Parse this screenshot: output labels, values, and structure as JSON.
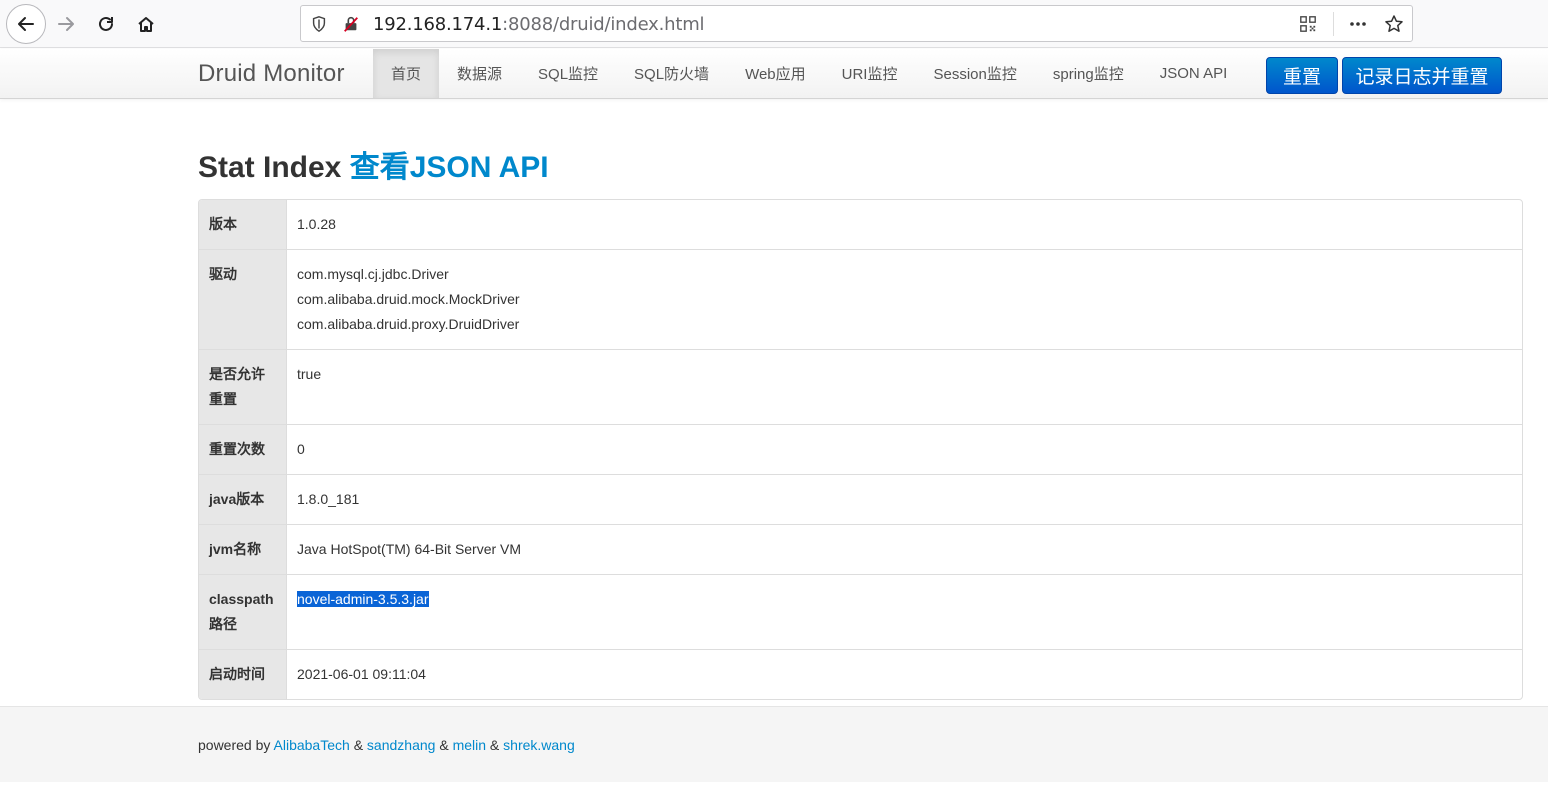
{
  "browser": {
    "url_host": "192.168.174.1",
    "url_rest": ":8088/druid/index.html"
  },
  "navbar": {
    "brand": "Druid Monitor",
    "items": [
      "首页",
      "数据源",
      "SQL监控",
      "SQL防火墙",
      "Web应用",
      "URI监控",
      "Session监控",
      "spring监控",
      "JSON API"
    ],
    "active_index": 0,
    "reset_label": "重置",
    "log_reset_label": "记录日志并重置"
  },
  "main": {
    "title": "Stat Index",
    "title_link": "查看JSON API",
    "rows": {
      "version": {
        "label": "版本",
        "value": "1.0.28"
      },
      "drivers": {
        "label": "驱动",
        "values": [
          "com.mysql.cj.jdbc.Driver",
          "com.alibaba.druid.mock.MockDriver",
          "com.alibaba.druid.proxy.DruidDriver"
        ]
      },
      "reset_enable": {
        "label": "是否允许重置",
        "value": "true"
      },
      "reset_count": {
        "label": "重置次数",
        "value": "0"
      },
      "java_version": {
        "label": "java版本",
        "value": "1.8.0_181"
      },
      "jvm_name": {
        "label": "jvm名称",
        "value": "Java HotSpot(TM) 64-Bit Server VM"
      },
      "classpath": {
        "label": "classpath路径",
        "value": "novel-admin-3.5.3.jar"
      },
      "start_time": {
        "label": "启动时间",
        "value": "2021-06-01 09:11:04"
      }
    }
  },
  "footer": {
    "prefix": "powered by",
    "sep": "&",
    "authors": [
      "AlibabaTech",
      "sandzhang",
      "melin",
      "shrek.wang"
    ]
  },
  "colors": {
    "link": "#0088cc",
    "button": "#0066cc",
    "selection": "#0a64d6"
  }
}
